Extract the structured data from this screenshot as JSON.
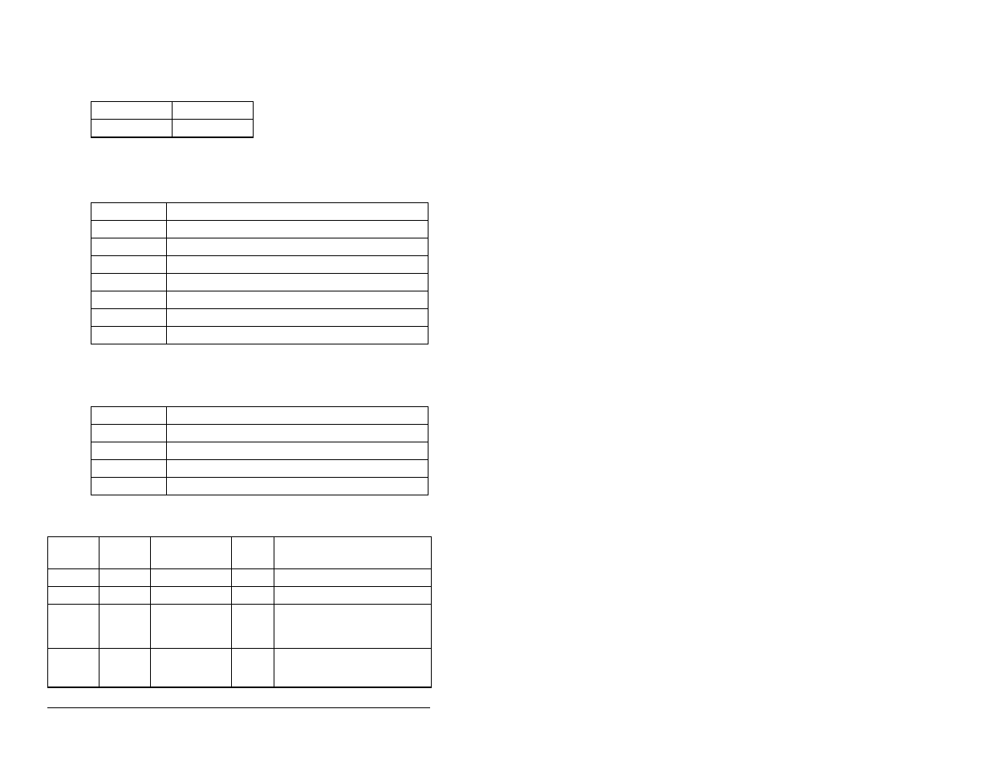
{
  "table1": {
    "rows": [
      [
        "",
        ""
      ],
      [
        "",
        ""
      ]
    ]
  },
  "table2": {
    "rows": [
      [
        "",
        ""
      ],
      [
        "",
        ""
      ],
      [
        "",
        ""
      ],
      [
        "",
        ""
      ],
      [
        "",
        ""
      ],
      [
        "",
        ""
      ],
      [
        "",
        ""
      ],
      [
        "",
        ""
      ]
    ]
  },
  "table3": {
    "rows": [
      [
        "",
        ""
      ],
      [
        "",
        ""
      ],
      [
        "",
        ""
      ],
      [
        "",
        ""
      ],
      [
        "",
        ""
      ]
    ]
  },
  "table4": {
    "rows": [
      [
        "",
        "",
        "",
        "",
        ""
      ],
      [
        "",
        "",
        "",
        "",
        ""
      ],
      [
        "",
        "",
        "",
        "",
        ""
      ],
      [
        "",
        "",
        "",
        "",
        ""
      ],
      [
        "",
        "",
        "",
        "",
        ""
      ]
    ]
  }
}
